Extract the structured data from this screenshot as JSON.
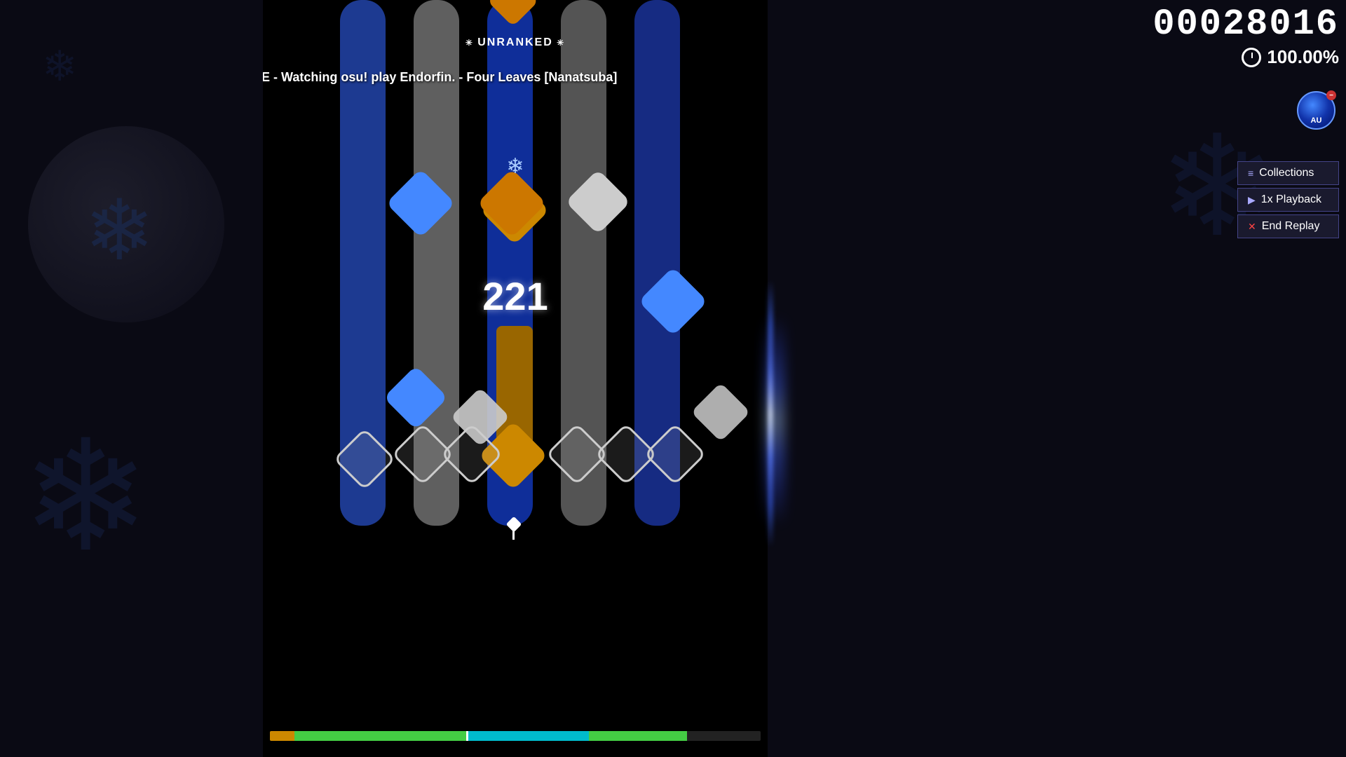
{
  "score": {
    "value": "00028016",
    "accuracy": "100.00%",
    "combo": "221"
  },
  "status": {
    "unranked": "UNRANKED",
    "replay_mode": "REPLAY MODE - Watching osu! play Endorfin. - Four Leaves [Nanatsuba]"
  },
  "avatar": {
    "label": "AU",
    "country": "AU"
  },
  "buttons": {
    "collections": "Collections",
    "playback": "1x Playback",
    "end_replay": "End Replay"
  },
  "snowflakes": {
    "symbol": "❄"
  },
  "progress": {
    "orange_pct": 5,
    "green_pct": 35,
    "blue_pct": 25,
    "green2_pct": 20,
    "remaining_pct": 15
  }
}
